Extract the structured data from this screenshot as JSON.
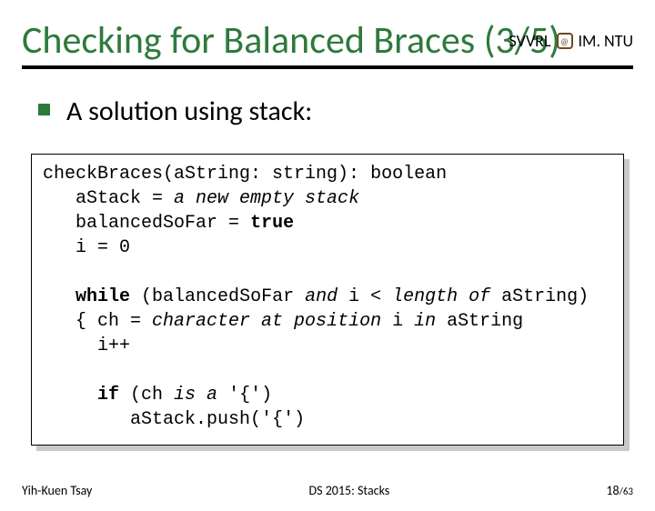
{
  "header": {
    "left_brand": "SVVRL",
    "right_brand": "IM. NTU"
  },
  "title": "Checking for Balanced Braces (3/5)",
  "bullet": "A solution using stack:",
  "code": {
    "l1a": "check",
    "l1b": "Braces(a",
    "l1c": "String: string): boolean",
    "l2a": "   a",
    "l2b": "Stack = ",
    "l2c": "a new empty stack",
    "l3a": "   balanced",
    "l3b": "So",
    "l3c": "Far = ",
    "l3d": "true",
    "l4": "   i = 0",
    "l5a": "   ",
    "l5b": "while",
    "l5c": " (balanced",
    "l5d": "So",
    "l5e": "Far ",
    "l5f": "and",
    "l5g": " i < ",
    "l5h": "length of ",
    "l5i": "a",
    "l5j": "String)",
    "l6a": "   { ch = ",
    "l6b": "character at position",
    "l6c": " i ",
    "l6d": "in ",
    "l6e": "a",
    "l6f": "String",
    "l7": "     i++",
    "l8a": "     ",
    "l8b": "if",
    "l8c": " (ch ",
    "l8d": "is a",
    "l8e": " '{')",
    "l9a": "        a",
    "l9b": "Stack",
    "l9c": ".push('{')"
  },
  "footer": {
    "author": "Yih-Kuen Tsay",
    "course": "DS 2015: Stacks",
    "page_current": "18",
    "page_sep": " / ",
    "page_total": "63"
  }
}
